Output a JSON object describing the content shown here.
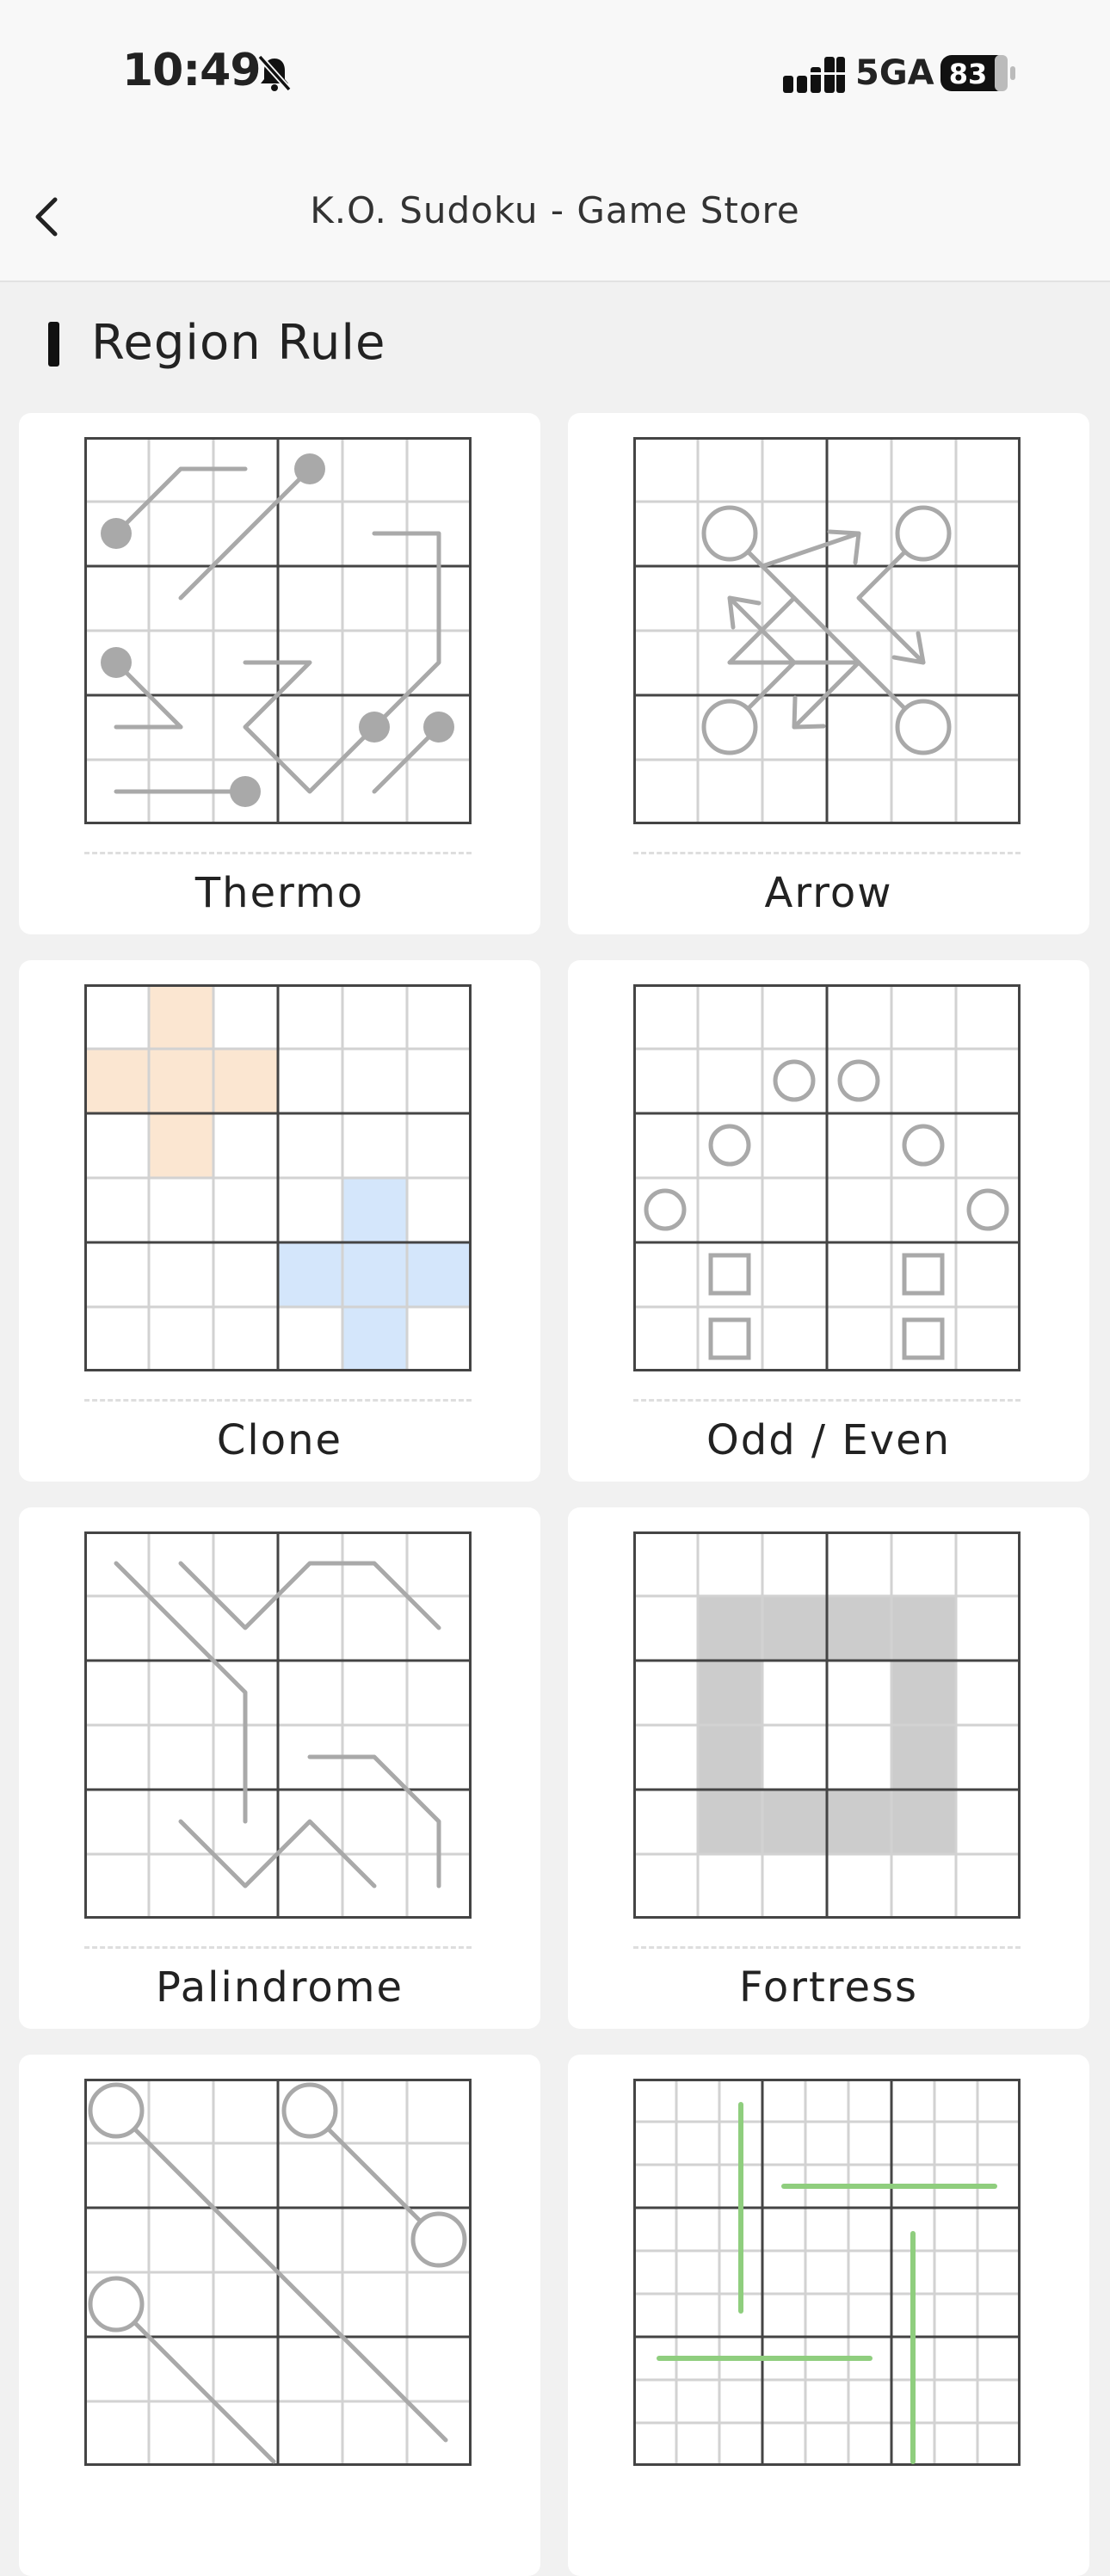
{
  "status_bar": {
    "time": "10:49",
    "network": "5GA",
    "battery": "83",
    "icons": [
      "bell-muted-icon",
      "signal-icon",
      "battery-icon"
    ]
  },
  "nav": {
    "title": "K.O. Sudoku - Game Store",
    "back_icon": "chevron-left-icon"
  },
  "section": {
    "title": "Region Rule"
  },
  "cards": [
    {
      "label": "Thermo"
    },
    {
      "label": "Arrow"
    },
    {
      "label": "Clone"
    },
    {
      "label": "Odd / Even"
    },
    {
      "label": "Palindrome"
    },
    {
      "label": "Fortress"
    },
    {
      "label": ""
    },
    {
      "label": ""
    }
  ],
  "colors": {
    "clone_orange": "#fbe6d1",
    "clone_blue": "#d4e6fb",
    "fortress_gray": "#cccccc",
    "line_gray": "#a9a9a9",
    "green_line": "#8fce7e"
  }
}
